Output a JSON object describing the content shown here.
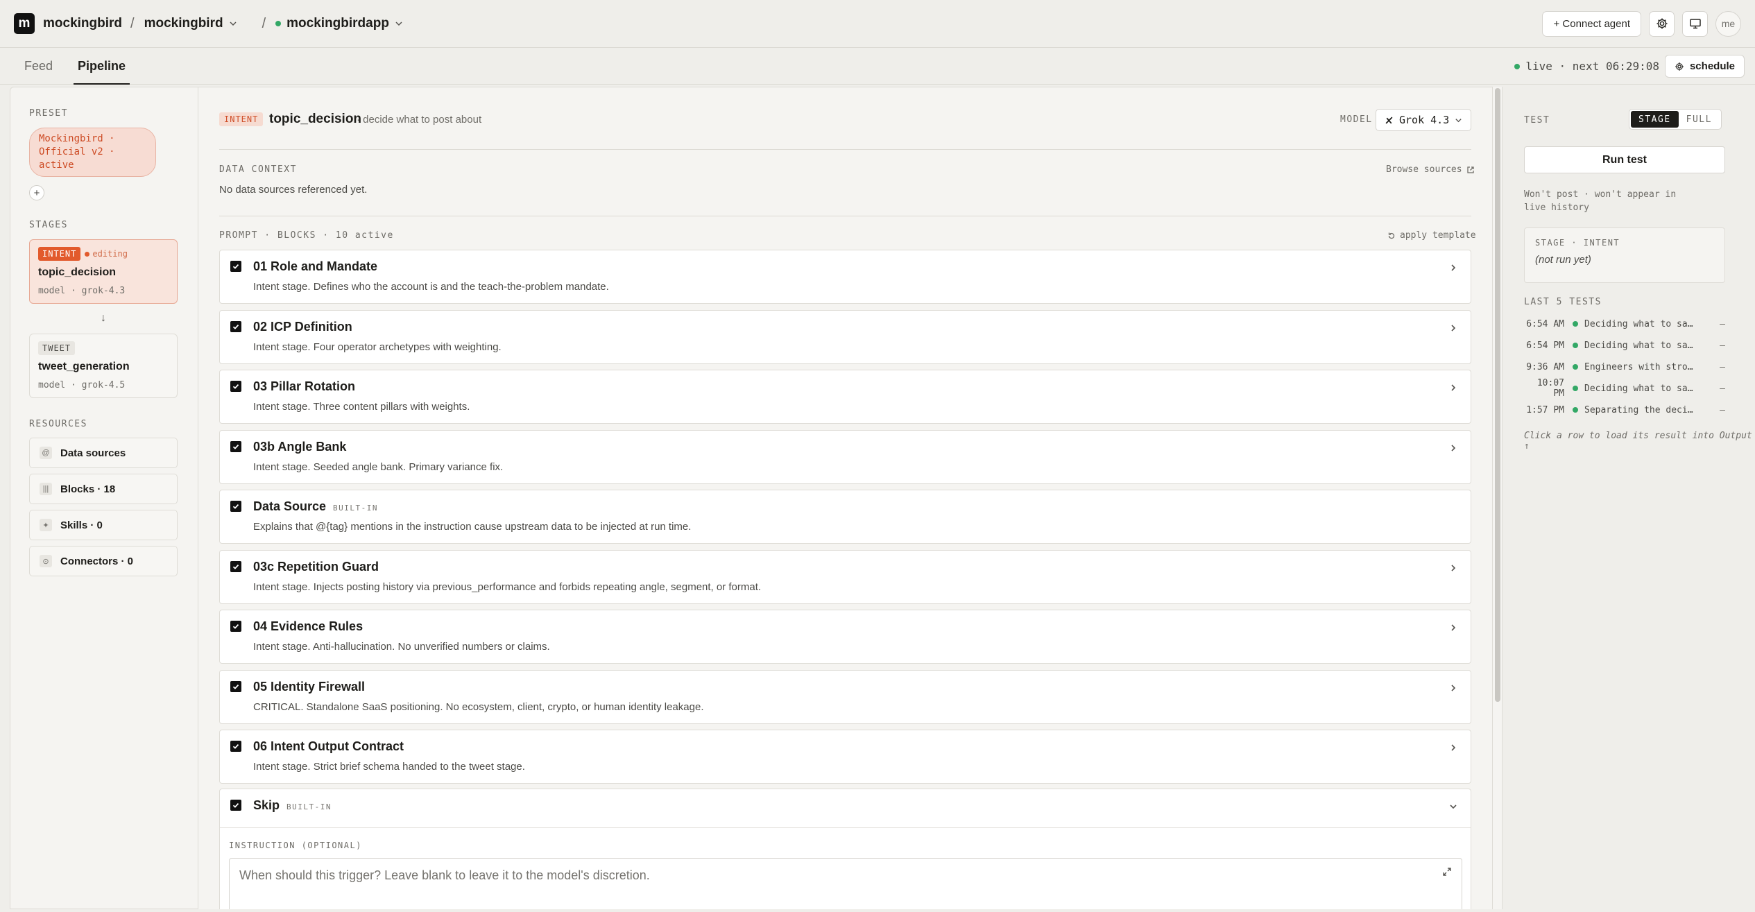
{
  "topbar": {
    "logo": "m",
    "org": "mockingbird",
    "project": "mockingbird",
    "app": "mockingbirdapp",
    "connect_label": "+ Connect agent",
    "avatar": "me"
  },
  "tabs": [
    {
      "label": "Feed",
      "active": false
    },
    {
      "label": "Pipeline",
      "active": true
    }
  ],
  "status": {
    "live_text": "live · next 06:29:08",
    "schedule_label": "schedule"
  },
  "left": {
    "preset_label": "PRESET",
    "preset_name": "Mockingbird · Official v2 · active",
    "add_label": "+",
    "stages_label": "STAGES",
    "stages": [
      {
        "tag": "INTENT",
        "status": "editing",
        "name": "topic_decision",
        "model": "model · grok-4.3"
      },
      {
        "tag": "TWEET",
        "status": "",
        "name": "tweet_generation",
        "model": "model · grok-4.5"
      }
    ],
    "arrow": "↓",
    "resources_label": "RESOURCES",
    "resources": [
      {
        "icon": "@",
        "label": "Data sources"
      },
      {
        "icon": "|||",
        "label": "Blocks · 18"
      },
      {
        "icon": "✦",
        "label": "Skills · 0"
      },
      {
        "icon": "⊙",
        "label": "Connectors · 0"
      }
    ]
  },
  "main": {
    "tag": "INTENT",
    "name": "topic_decision",
    "desc": "· decide what to post about",
    "model_label": "MODEL",
    "model_value": "Grok 4.3",
    "data_context_label": "DATA CONTEXT",
    "browse_label": "Browse sources",
    "data_context_text": "No data sources referenced yet.",
    "prompt_label": "PROMPT · BLOCKS · 10 active",
    "apply_label": "apply template",
    "blocks": [
      {
        "title": "01 Role and Mandate",
        "badge": "",
        "desc": "Intent stage. Defines who the account is and the teach-the-problem mandate.",
        "chevron": true
      },
      {
        "title": "02 ICP Definition",
        "badge": "",
        "desc": "Intent stage. Four operator archetypes with weighting.",
        "chevron": true
      },
      {
        "title": "03 Pillar Rotation",
        "badge": "",
        "desc": "Intent stage. Three content pillars with weights.",
        "chevron": true
      },
      {
        "title": "03b Angle Bank",
        "badge": "",
        "desc": "Intent stage. Seeded angle bank. Primary variance fix.",
        "chevron": true
      },
      {
        "title": "Data Source",
        "badge": "BUILT-IN",
        "desc": "Explains that @{tag} mentions in the instruction cause upstream data to be injected at run time.",
        "chevron": false
      },
      {
        "title": "03c Repetition Guard",
        "badge": "",
        "desc": "Intent stage. Injects posting history via previous_performance and forbids repeating angle, segment, or format.",
        "chevron": true
      },
      {
        "title": "04 Evidence Rules",
        "badge": "",
        "desc": "Intent stage. Anti-hallucination. No unverified numbers or claims.",
        "chevron": true
      },
      {
        "title": "05 Identity Firewall",
        "badge": "",
        "desc": "CRITICAL. Standalone SaaS positioning. No ecosystem, client, crypto, or human identity leakage.",
        "chevron": true
      },
      {
        "title": "06 Intent Output Contract",
        "badge": "",
        "desc": "Intent stage. Strict brief schema handed to the tweet stage.",
        "chevron": true
      }
    ],
    "skip": {
      "title": "Skip",
      "badge": "BUILT-IN",
      "instruction_label": "INSTRUCTION (OPTIONAL)",
      "placeholder": "When should this trigger? Leave blank to leave it to the model's discretion."
    }
  },
  "right": {
    "test_label": "TEST",
    "seg_stage": "STAGE",
    "seg_full": "FULL",
    "run_label": "Run test",
    "wont_post": "Won't post · won't appear in live history",
    "stage_box_label": "STAGE · INTENT",
    "stage_box_value": "(not run yet)",
    "last_label": "LAST 5 TESTS",
    "tests": [
      {
        "time": "6:54 AM",
        "text": "Deciding what to say about",
        "result": "—"
      },
      {
        "time": "6:54 PM",
        "text": "Deciding what to say about",
        "result": "—"
      },
      {
        "time": "9:36 AM",
        "text": "Engineers with strong",
        "result": "—"
      },
      {
        "time": "10:07 PM",
        "text": "Deciding what to say about",
        "result": "—"
      },
      {
        "time": "1:57 PM",
        "text": "Separating the decision",
        "result": "—"
      }
    ],
    "hint": "Click a row to load its result into Output ↑"
  },
  "colors": {
    "accent": "#e25a2c",
    "live": "#33a866",
    "dark": "#1e1d1a"
  }
}
